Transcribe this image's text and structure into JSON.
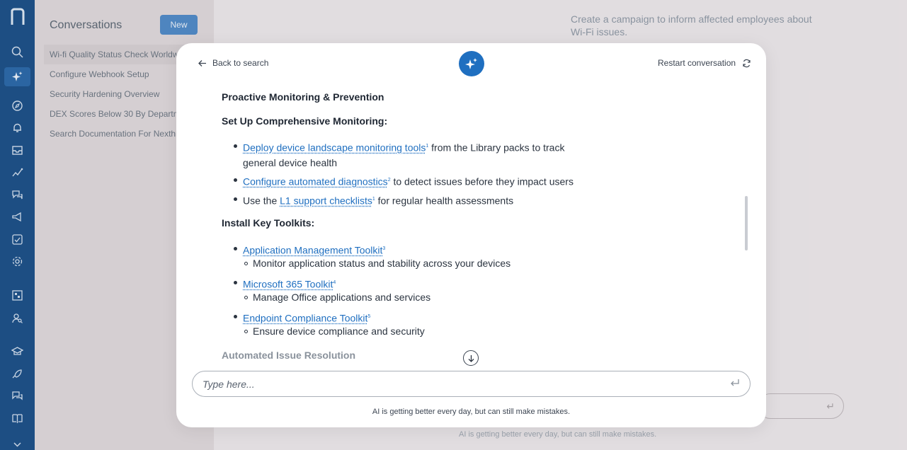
{
  "conversations": {
    "title": "Conversations",
    "new_label": "New",
    "items": [
      {
        "label": "Wi-fi Quality Status Check Worldwi..."
      },
      {
        "label": "Configure Webhook Setup"
      },
      {
        "label": "Security Hardening Overview"
      },
      {
        "label": "DEX Scores Below 30 By Departme..."
      },
      {
        "label": "Search Documentation For Nexthin..."
      }
    ]
  },
  "background": {
    "message": "Create a campaign to inform affected employees about Wi-Fi issues.",
    "disclaimer": "AI is getting better every day, but can still make mistakes."
  },
  "modal": {
    "back_label": "Back to search",
    "restart_label": "Restart conversation",
    "content": {
      "h1": "Proactive Monitoring & Prevention",
      "h2": "Set Up Comprehensive Monitoring:",
      "b1": {
        "link": "Deploy device landscape monitoring tools",
        "sup": "1",
        "text_a": " from the Library packs to track",
        "text_b": "general device health"
      },
      "b2": {
        "link": "Configure automated diagnostics",
        "sup": "2",
        "text": " to detect issues before they impact users"
      },
      "b3": {
        "pre": "Use the ",
        "link": "L1 support checklists",
        "sup": "1",
        "text": " for regular health assessments"
      },
      "h3": "Install Key Toolkits:",
      "t1": {
        "link": "Application Management Toolkit",
        "sup": "3",
        "desc": "Monitor application status and stability across your devices"
      },
      "t2": {
        "link": "Microsoft 365 Toolkit",
        "sup": "4",
        "desc": "Manage Office applications and services"
      },
      "t3": {
        "link": "Endpoint Compliance Toolkit",
        "sup": "5",
        "desc": "Ensure device compliance and security"
      },
      "h4": "Automated Issue Resolution"
    },
    "input_placeholder": "Type here...",
    "disclaimer": "AI is getting better every day, but can still make mistakes."
  },
  "colors": {
    "rail": "#1c4f86",
    "accent": "#1f6fc0",
    "new_button": "#4f88c4"
  },
  "icons": {
    "rail": [
      "logo-icon",
      "search-icon",
      "sparkle-icon",
      "compass-icon",
      "bell-icon",
      "inbox-icon",
      "insights-icon",
      "chat-group-icon",
      "campaign-icon",
      "checklist-icon",
      "settings-gear-icon",
      "library-icon",
      "search-user-icon",
      "academy-icon",
      "rocket-icon",
      "messages-icon",
      "book-icon",
      "chevron-down-icon"
    ]
  }
}
